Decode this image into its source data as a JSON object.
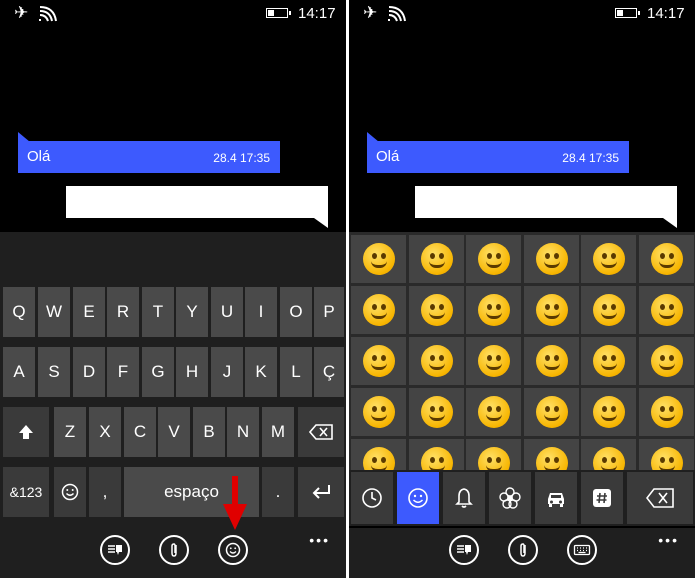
{
  "status": {
    "time": "14:17"
  },
  "message": {
    "text": "Olá",
    "timestamp": "28.4 17:35"
  },
  "keyboard": {
    "row1": [
      "Q",
      "W",
      "E",
      "R",
      "T",
      "Y",
      "U",
      "I",
      "O",
      "P"
    ],
    "row2": [
      "A",
      "S",
      "D",
      "F",
      "G",
      "H",
      "J",
      "K",
      "L",
      "Ç"
    ],
    "row3": [
      "Z",
      "X",
      "C",
      "V",
      "B",
      "N",
      "M"
    ],
    "symbols_label": "&123",
    "comma": ",",
    "space_label": "espaço",
    "period": "."
  },
  "icons": {
    "status": [
      "airplane-icon",
      "wifi-icon",
      "battery-icon"
    ],
    "bottom_left": [
      "keyboard-toggle-icon",
      "attach-icon",
      "emoji-icon"
    ],
    "bottom_right": [
      "keyboard-toggle-icon",
      "attach-icon",
      "keyboard-icon"
    ],
    "emoji_categories": [
      "recent-icon",
      "smiley-icon",
      "bell-icon",
      "flower-icon",
      "car-icon",
      "hash-icon",
      "backspace-icon"
    ]
  },
  "colors": {
    "accent": "#3d5afe",
    "key": "#4a4a4a",
    "background": "#000000",
    "arrow": "#e00000"
  }
}
